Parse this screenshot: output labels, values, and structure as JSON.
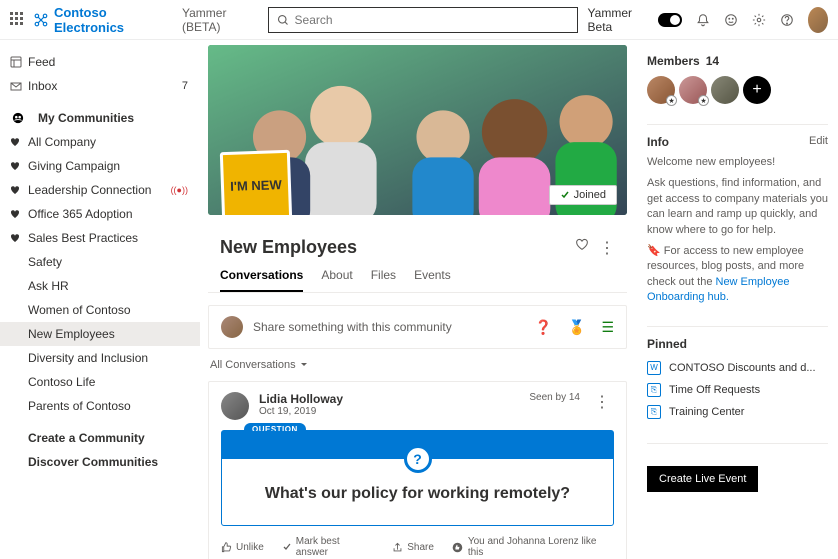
{
  "header": {
    "brand": "Contoso Electronics",
    "product": "Yammer (BETA)",
    "search_placeholder": "Search",
    "beta_label": "Yammer Beta"
  },
  "sidebar": {
    "feed": "Feed",
    "inbox": "Inbox",
    "inbox_count": "7",
    "my_communities": "My Communities",
    "items": [
      {
        "label": "All Company",
        "fav": true
      },
      {
        "label": "Giving Campaign",
        "fav": true
      },
      {
        "label": "Leadership Connection",
        "fav": true,
        "live": true
      },
      {
        "label": "Office 365 Adoption",
        "fav": true
      },
      {
        "label": "Sales Best Practices",
        "fav": true
      },
      {
        "label": "Safety"
      },
      {
        "label": "Ask HR"
      },
      {
        "label": "Women of Contoso"
      },
      {
        "label": "New Employees",
        "selected": true
      },
      {
        "label": "Diversity and Inclusion"
      },
      {
        "label": "Contoso Life"
      },
      {
        "label": "Parents of Contoso"
      }
    ],
    "create": "Create a Community",
    "discover": "Discover Communities"
  },
  "group": {
    "sticky": "I'M NEW",
    "joined": "Joined",
    "title": "New Employees",
    "tabs": [
      "Conversations",
      "About",
      "Files",
      "Events"
    ],
    "composer_placeholder": "Share something with this community",
    "filter": "All Conversations"
  },
  "post": {
    "author": "Lidia Holloway",
    "date": "Oct 19, 2019",
    "seen": "Seen by 14",
    "tag": "QUESTION",
    "question": "What's our policy for working remotely?",
    "actions": {
      "unlike": "Unlike",
      "best": "Mark best answer",
      "share": "Share"
    },
    "likes": "You and Johanna Lorenz like this"
  },
  "rail": {
    "members_label": "Members",
    "members_count": "14",
    "info": "Info",
    "edit": "Edit",
    "welcome": "Welcome new employees!",
    "desc": "Ask questions, find information, and get access to company materials you can learn and ramp up quickly, and know where to go for help.",
    "tip_pre": "For access to new employee resources, blog posts, and more check out the ",
    "tip_link": "New Employee Onboarding hub.",
    "pinned_label": "Pinned",
    "pinned": [
      {
        "icon": "W",
        "label": "CONTOSO Discounts and d..."
      },
      {
        "icon": "⎘",
        "label": "Time Off Requests"
      },
      {
        "icon": "⎘",
        "label": "Training Center"
      }
    ],
    "live_btn": "Create Live Event"
  }
}
